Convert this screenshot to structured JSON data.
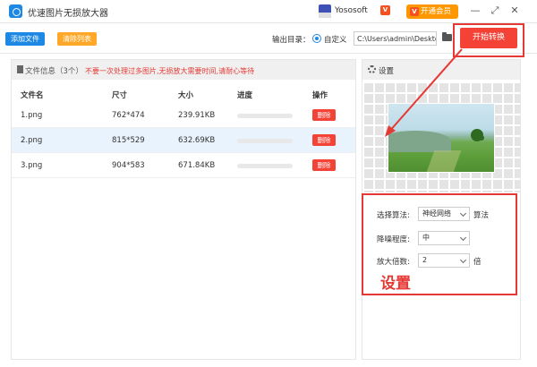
{
  "app": {
    "title": "优速图片无损放大器"
  },
  "user": {
    "name": "Yososoft",
    "badge": "V",
    "vip_label": "开通会员",
    "vip_icon": "V"
  },
  "window": {
    "minimize": "—",
    "restore": "⛶",
    "maximize": "⤢",
    "close": "✕"
  },
  "toolbar": {
    "add_label": "添加文件",
    "clear_label": "清除列表",
    "output_label": "输出目录：",
    "radio_label": "自定义",
    "path_value": "C:\\Users\\admin\\Deskto",
    "start_label": "开始转换"
  },
  "files": {
    "header": "文件信息（3个）",
    "warning": "不要一次处理过多图片,无损放大需要时间,请耐心等待",
    "columns": [
      "文件名",
      "尺寸",
      "大小",
      "进度",
      "操作"
    ],
    "rows": [
      {
        "name": "1.png",
        "dims": "762*474",
        "size": "239.91KB",
        "progress": 0,
        "action": "删除"
      },
      {
        "name": "2.png",
        "dims": "815*529",
        "size": "632.69KB",
        "progress": 0,
        "action": "删除"
      },
      {
        "name": "3.png",
        "dims": "904*583",
        "size": "671.84KB",
        "progress": 0,
        "action": "删除"
      }
    ],
    "selected_row": 1
  },
  "settings": {
    "title": "设置",
    "algo_label": "选择算法:",
    "algo_value": "神经网络",
    "algo_suffix": "算法",
    "noise_label": "降噪程度:",
    "noise_value": "中",
    "scale_label": "放大倍数:",
    "scale_value": "2",
    "scale_suffix": "倍",
    "annotation": "设置"
  },
  "colors": {
    "accent": "#1e88e5",
    "danger": "#f44336",
    "warning": "#ffa726",
    "vip": "#ff9800"
  }
}
